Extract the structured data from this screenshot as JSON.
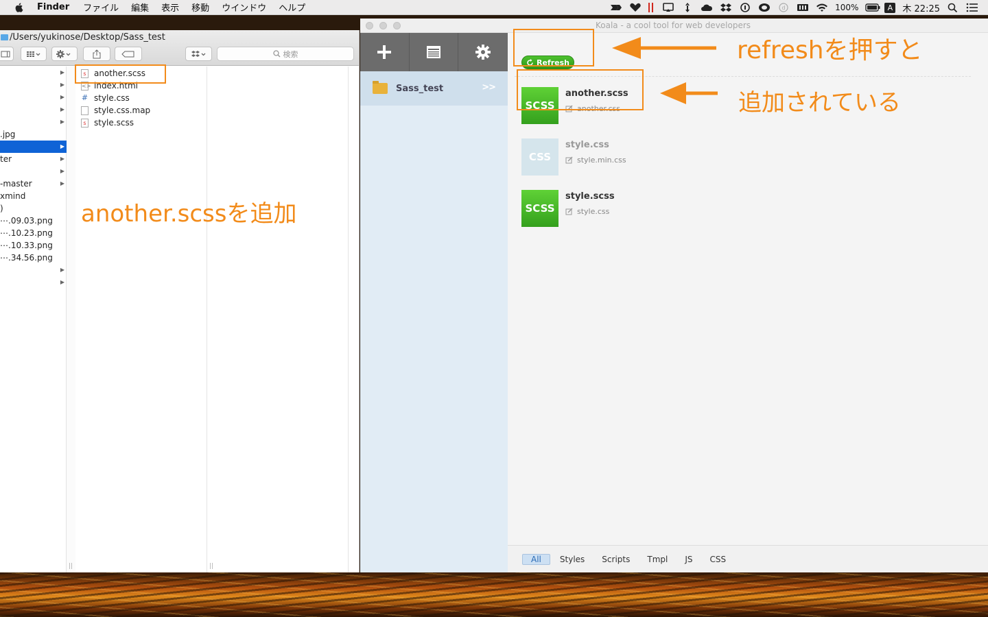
{
  "menubar": {
    "app_name": "Finder",
    "items": [
      "ファイル",
      "編集",
      "表示",
      "移動",
      "ウインドウ",
      "ヘルプ"
    ],
    "battery_text": "100%",
    "ime": "A",
    "clock": "木 22:25"
  },
  "finder": {
    "path": "/Users/yukinose/Desktop/Sass_test",
    "search_placeholder": "検索",
    "column1_rows": [
      {
        "label": "",
        "arrow": true
      },
      {
        "label": "",
        "arrow": true
      },
      {
        "label": "",
        "arrow": true
      },
      {
        "label": "",
        "arrow": true
      },
      {
        "label": "",
        "arrow": true
      },
      {
        "label": ".jpg",
        "arrow": false
      },
      {
        "label": "",
        "arrow": true
      },
      {
        "label": "ter",
        "arrow": true
      },
      {
        "label": "",
        "arrow": true
      },
      {
        "label": "-master",
        "arrow": true
      },
      {
        "label": "xmind",
        "arrow": false
      },
      {
        "label": ")",
        "arrow": false
      },
      {
        "label": "⋯.09.03.png",
        "arrow": false
      },
      {
        "label": "⋯.10.23.png",
        "arrow": false
      },
      {
        "label": "⋯.10.33.png",
        "arrow": false
      },
      {
        "label": "⋯.34.56.png",
        "arrow": false
      },
      {
        "label": "",
        "arrow": true
      },
      {
        "label": "",
        "arrow": true
      }
    ],
    "files": [
      {
        "name": "another.scss",
        "icon": "scss-file-icon"
      },
      {
        "name": "index.html",
        "icon": "html-file-icon"
      },
      {
        "name": "style.css",
        "icon": "css-file-icon"
      },
      {
        "name": "style.css.map",
        "icon": "blank-file-icon"
      },
      {
        "name": "style.scss",
        "icon": "scss-file-icon"
      }
    ]
  },
  "koala": {
    "title": "Koala - a cool tool for web developers",
    "project": {
      "name": "Sass_test",
      "go": ">>"
    },
    "refresh_label": "Refresh",
    "files": [
      {
        "badge": "SCSS",
        "name": "another.scss",
        "output": "another.css",
        "type": "scss"
      },
      {
        "badge": "CSS",
        "name": "style.css",
        "output": "style.min.css",
        "type": "css"
      },
      {
        "badge": "SCSS",
        "name": "style.scss",
        "output": "style.css",
        "type": "scss"
      }
    ],
    "filters": [
      "All",
      "Styles",
      "Scripts",
      "Tmpl",
      "JS",
      "CSS"
    ],
    "active_filter": "All"
  },
  "annotations": {
    "refresh_note": "refreshを押すと",
    "added_note": "追加されている",
    "finder_note": "another.scssを追加",
    "color": "#f28b1a"
  }
}
